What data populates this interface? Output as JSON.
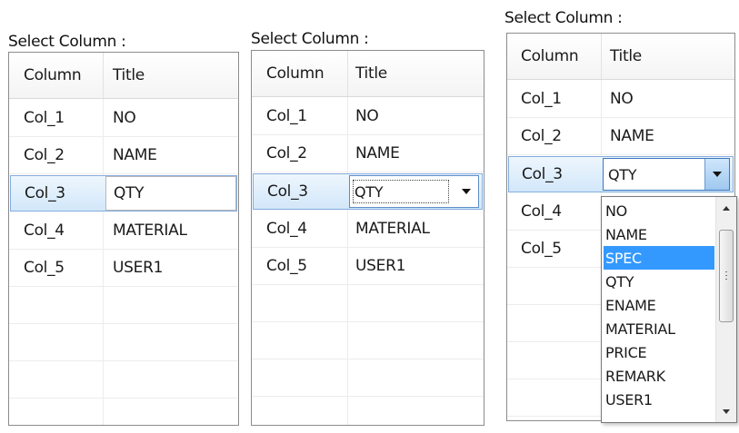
{
  "panels": [
    {
      "title": "Select Column :",
      "headers": {
        "column": "Column",
        "title": "Title"
      },
      "rows": [
        {
          "column": "Col_1",
          "title": "NO"
        },
        {
          "column": "Col_2",
          "title": "NAME"
        },
        {
          "column": "Col_3",
          "title": "QTY"
        },
        {
          "column": "Col_4",
          "title": "MATERIAL"
        },
        {
          "column": "Col_5",
          "title": "USER1"
        }
      ],
      "selected_row": "Col_3"
    },
    {
      "title": "Select Column :",
      "headers": {
        "column": "Column",
        "title": "Title"
      },
      "rows": [
        {
          "column": "Col_1",
          "title": "NO"
        },
        {
          "column": "Col_2",
          "title": "NAME"
        },
        {
          "column": "Col_3",
          "title": "QTY"
        },
        {
          "column": "Col_4",
          "title": "MATERIAL"
        },
        {
          "column": "Col_5",
          "title": "USER1"
        }
      ],
      "selected_row": "Col_3",
      "editor_value": "QTY"
    },
    {
      "title": "Select Column :",
      "headers": {
        "column": "Column",
        "title": "Title"
      },
      "rows": [
        {
          "column": "Col_1",
          "title": "NO"
        },
        {
          "column": "Col_2",
          "title": "NAME"
        },
        {
          "column": "Col_3",
          "title": "QTY"
        },
        {
          "column": "Col_4",
          "title": ""
        },
        {
          "column": "Col_5",
          "title": ""
        }
      ],
      "selected_row": "Col_3",
      "editor_value": "QTY",
      "dropdown_options": [
        "NO",
        "NAME",
        "SPEC",
        "QTY",
        "ENAME",
        "MATERIAL",
        "PRICE",
        "REMARK",
        "USER1"
      ],
      "dropdown_highlighted": "SPEC"
    }
  ],
  "colors": {
    "selection": "#d2e7fa",
    "highlight": "#3399ff",
    "border": "#8c8c8c"
  }
}
